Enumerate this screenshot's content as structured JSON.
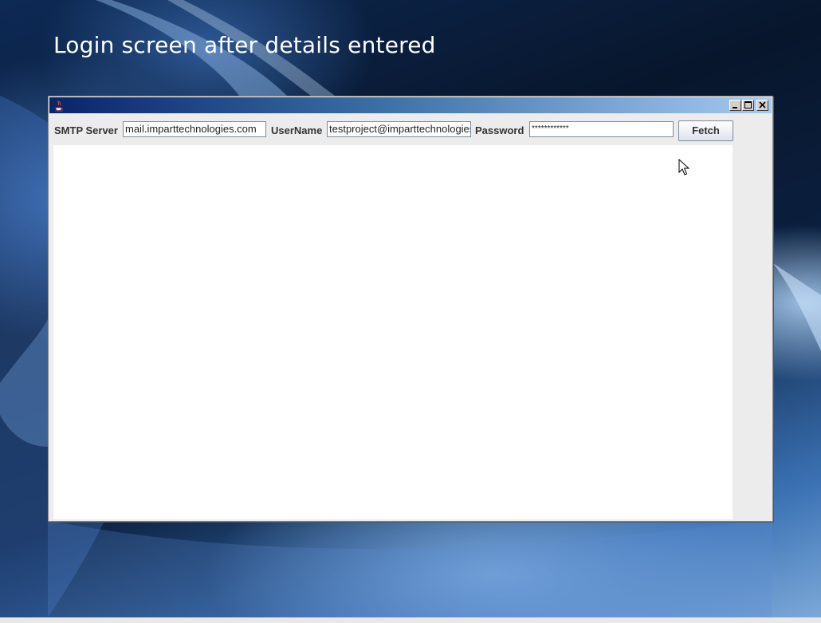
{
  "slide": {
    "title": "Login screen after details entered"
  },
  "window": {
    "title": "",
    "controls": {
      "minimize_icon": "minimize-icon",
      "maximize_icon": "maximize-icon",
      "close_icon": "close-icon"
    },
    "app_icon": "java-coffee-icon"
  },
  "form": {
    "smtp_label": "SMTP Server",
    "smtp_value": "mail.imparttechnologies.com",
    "username_label": "UserName",
    "username_value": "testproject@imparttechnologies",
    "password_label": "Password",
    "password_value": "************",
    "fetch_label": "Fetch"
  },
  "colors": {
    "titlebar_start": "#0a246a",
    "titlebar_end": "#a6caf0",
    "window_bg": "#ececec"
  }
}
